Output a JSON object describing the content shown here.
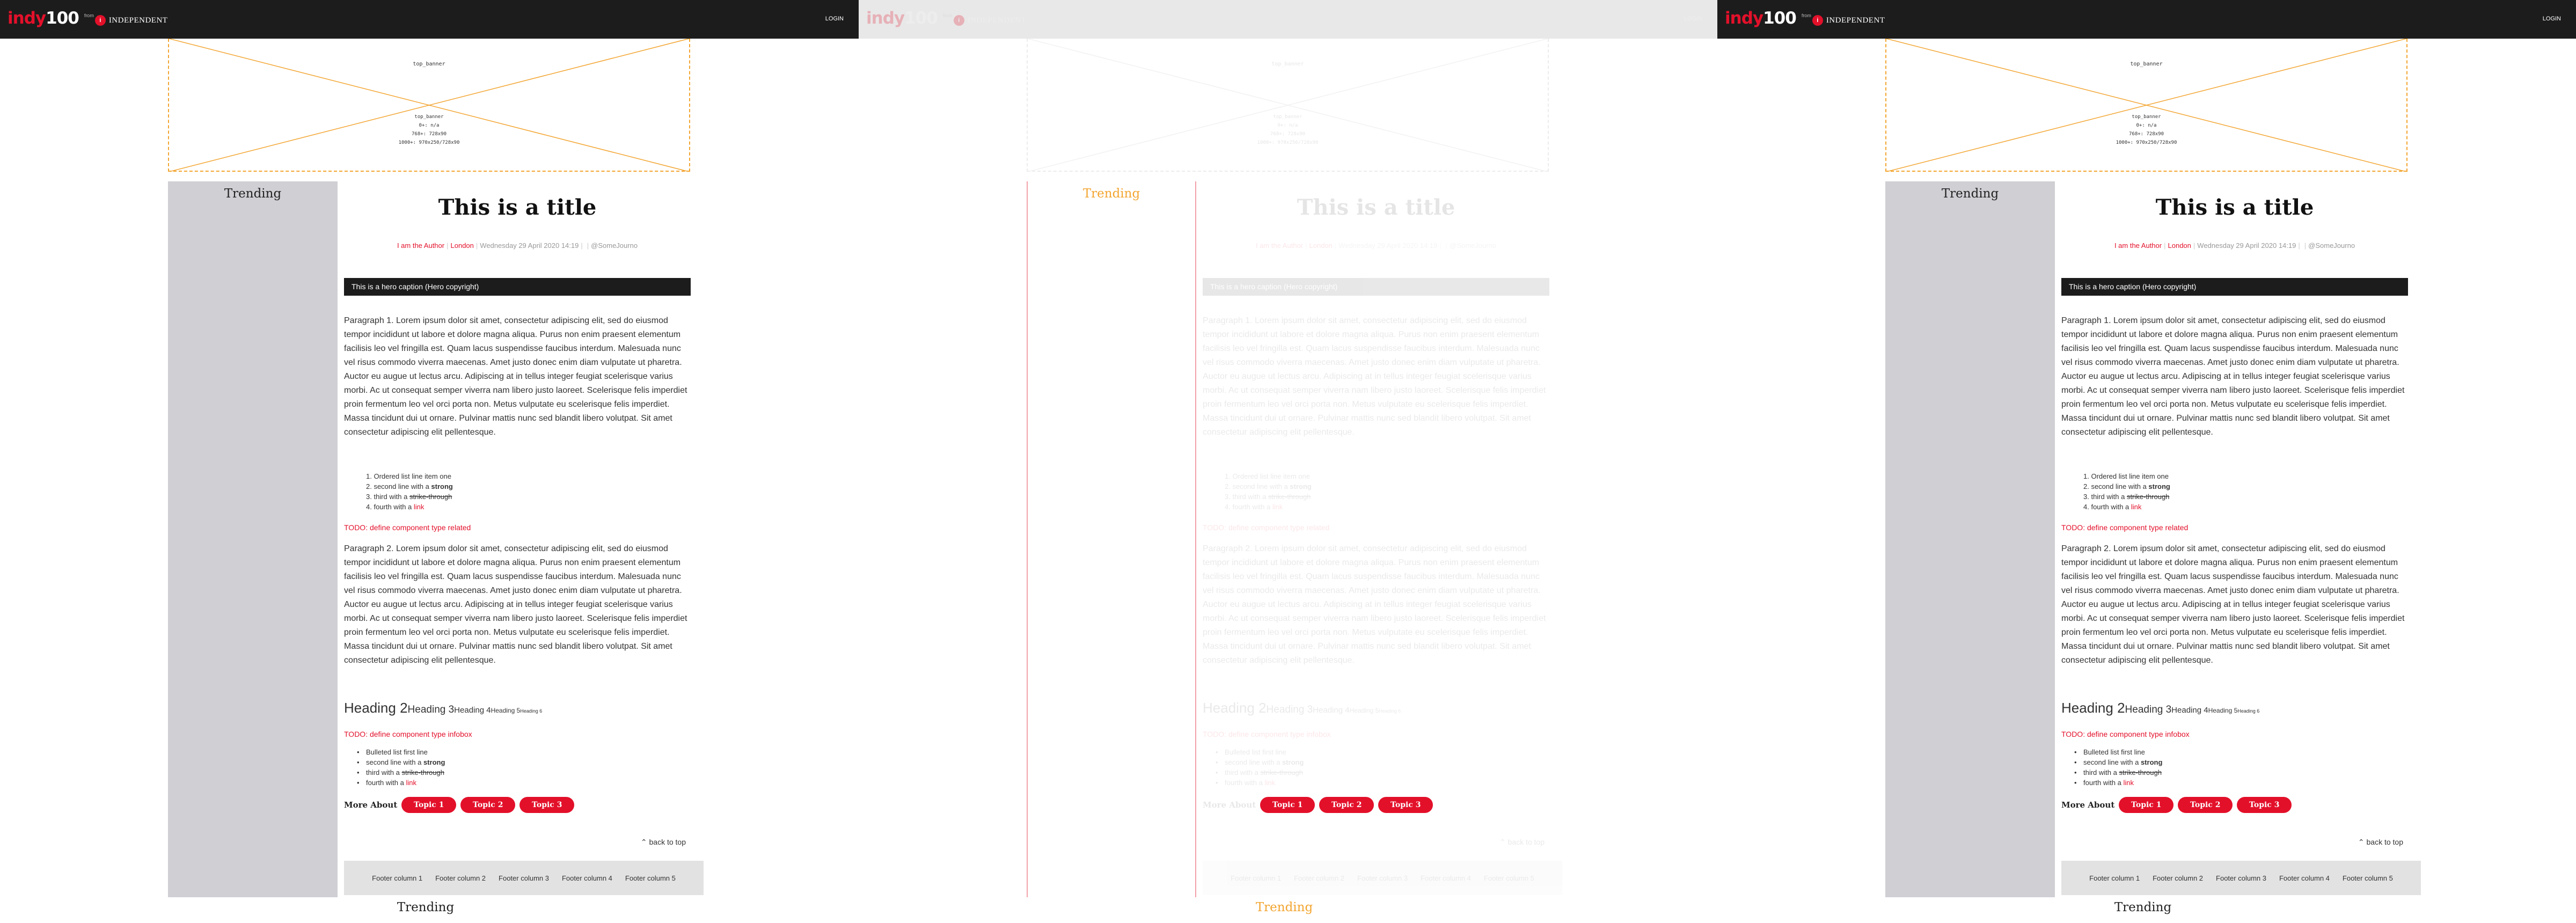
{
  "site": {
    "logo_indy": "indy",
    "logo_num": "100",
    "logo_from": "from",
    "logo_mark": "i",
    "logo_publisher": "INDEPENDENT",
    "login_label": "LOGIN"
  },
  "banner": {
    "title": "top_banner",
    "info": [
      "top_banner",
      "0+: n/a",
      "768+: 728x90",
      "1000+: 970x250/728x90"
    ]
  },
  "sidebar": {
    "title": "Trending",
    "bottom_title": "Trending"
  },
  "article": {
    "title": "This is a title",
    "author": "I am the Author",
    "location": "London",
    "date": "Wednesday 29 April 2020 14:19",
    "twitter": "@SomeJourno",
    "hero_caption": "This is a hero caption (Hero copyright)",
    "paragraph1": "Paragraph 1. Lorem ipsum dolor sit amet, consectetur adipiscing elit, sed do eiusmod tempor incididunt ut labore et dolore magna aliqua. Purus non enim praesent elementum facilisis leo vel fringilla est. Quam lacus suspendisse faucibus interdum. Malesuada nunc vel risus commodo viverra maecenas. Amet justo donec enim diam vulputate ut pharetra. Auctor eu augue ut lectus arcu. Adipiscing at in tellus integer feugiat scelerisque varius morbi. Ac ut consequat semper viverra nam libero justo laoreet. Scelerisque felis imperdiet proin fermentum leo vel orci porta non. Metus vulputate eu scelerisque felis imperdiet. Massa tincidunt dui ut ornare. Pulvinar mattis nunc sed blandit libero volutpat. Sit amet consectetur adipiscing elit pellentesque.",
    "paragraph2": "Paragraph 2. Lorem ipsum dolor sit amet, consectetur adipiscing elit, sed do eiusmod tempor incididunt ut labore et dolore magna aliqua. Purus non enim praesent elementum facilisis leo vel fringilla est. Quam lacus suspendisse faucibus interdum. Malesuada nunc vel risus commodo viverra maecenas. Amet justo donec enim diam vulputate ut pharetra. Auctor eu augue ut lectus arcu. Adipiscing at in tellus integer feugiat scelerisque varius morbi. Ac ut consequat semper viverra nam libero justo laoreet. Scelerisque felis imperdiet proin fermentum leo vel orci porta non. Metus vulputate eu scelerisque felis imperdiet. Massa tincidunt dui ut ornare. Pulvinar mattis nunc sed blandit libero volutpat. Sit amet consectetur adipiscing elit pellentesque.",
    "ordered_list": {
      "item1": "1. Ordered list line item one",
      "item2_prefix": "2. second line with a ",
      "item2_strong": "strong",
      "item3_prefix": "3. third with a ",
      "item3_strike": "strike-through",
      "item4_prefix": "4. fourth with a ",
      "item4_link": "link"
    },
    "todo_related": "TODO: define component type related",
    "headings": {
      "h2": "Heading 2",
      "h3": "Heading 3",
      "h4": "Heading 4",
      "h5": "Heading 5",
      "h6": "Heading 6"
    },
    "todo_infobox": "TODO: define component type infobox",
    "bullet_list": {
      "item1": "Bulleted list first line",
      "item2_prefix": "second line with a ",
      "item2_strong": "strong",
      "item3_prefix": "third with a ",
      "item3_strike": "strike-through",
      "item4_prefix": "fourth with a ",
      "item4_link": "link"
    },
    "more_about_label": "More About",
    "topics": [
      "Topic 1",
      "Topic 2",
      "Topic 3"
    ],
    "back_to_top": "back to top"
  },
  "footer": {
    "columns": [
      "Footer column 1",
      "Footer column 2",
      "Footer column 3",
      "Footer column 4",
      "Footer column 5"
    ]
  },
  "colors": {
    "brand_red": "#e3102a",
    "nav_dark": "#1c1c1c",
    "sidebar_grey": "#cfcfd4",
    "ad_outline_orange": "#f3a531"
  }
}
